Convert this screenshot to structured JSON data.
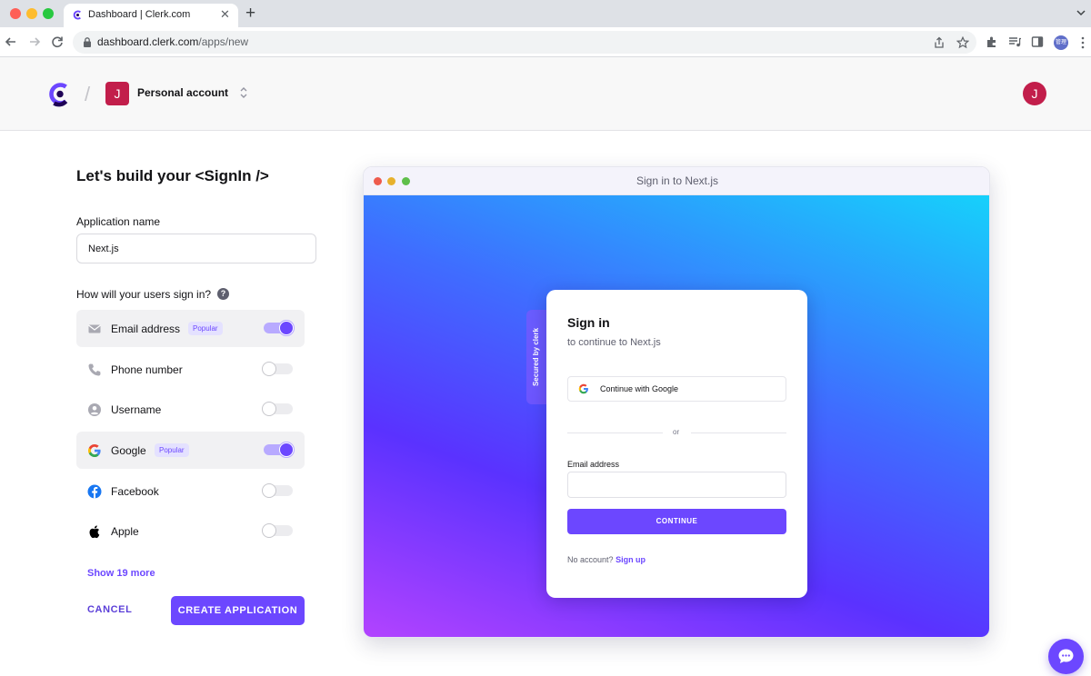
{
  "browser": {
    "tab_title": "Dashboard | Clerk.com",
    "url_host": "dashboard.clerk.com",
    "url_path": "/apps/new",
    "profile_chip": "管理"
  },
  "header": {
    "separator": "/",
    "org_initial": "J",
    "org_name": "Personal account",
    "user_initial": "J"
  },
  "form": {
    "title": "Let's build your <SignIn />",
    "app_name_label": "Application name",
    "app_name_value": "Next.js",
    "signin_question": "How will your users sign in?",
    "help_glyph": "?",
    "options": [
      {
        "label": "Email address",
        "badge": "Popular",
        "enabled": true,
        "icon": "mail-icon"
      },
      {
        "label": "Phone number",
        "badge": "",
        "enabled": false,
        "icon": "phone-icon"
      },
      {
        "label": "Username",
        "badge": "",
        "enabled": false,
        "icon": "user-icon"
      },
      {
        "label": "Google",
        "badge": "Popular",
        "enabled": true,
        "icon": "google-icon"
      },
      {
        "label": "Facebook",
        "badge": "",
        "enabled": false,
        "icon": "facebook-icon"
      },
      {
        "label": "Apple",
        "badge": "",
        "enabled": false,
        "icon": "apple-icon"
      }
    ],
    "show_more": "Show 19 more",
    "cancel": "CANCEL",
    "create": "CREATE APPLICATION"
  },
  "preview": {
    "window_title": "Sign in to Next.js",
    "secured_by": "Secured by",
    "secured_brand": "clerk",
    "card_title": "Sign in",
    "card_subtitle": "to continue to Next.js",
    "google_button": "Continue with Google",
    "divider": "or",
    "email_label": "Email address",
    "continue": "CONTINUE",
    "no_account": "No account?",
    "sign_up": "Sign up"
  },
  "colors": {
    "accent": "#6c47ff",
    "avatar": "#c21e4b"
  }
}
